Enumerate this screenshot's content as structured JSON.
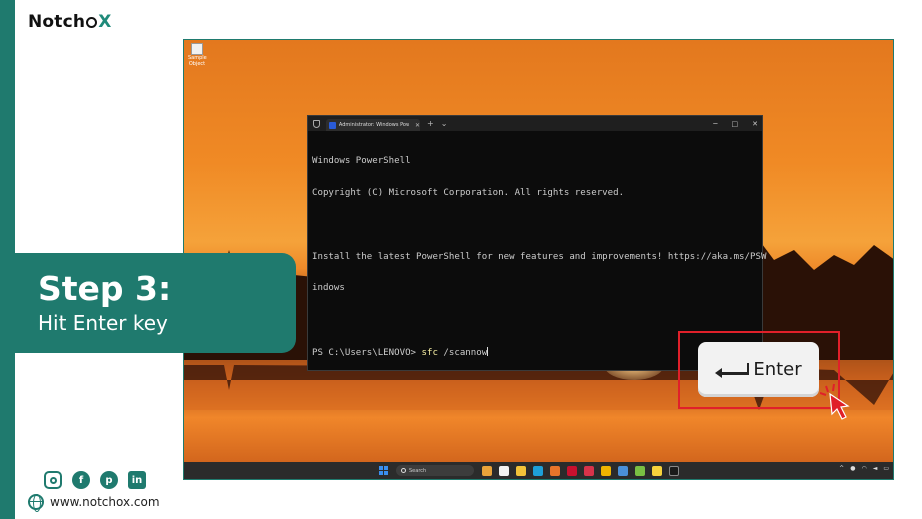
{
  "brand": {
    "name_part1": "Notch",
    "name_part2": "X"
  },
  "step": {
    "title": "Step 3:",
    "subtitle": "Hit Enter key"
  },
  "footer": {
    "website": "www.notchox.com",
    "socials": [
      "instagram-icon",
      "facebook-icon",
      "pinterest-icon",
      "linkedin-icon"
    ]
  },
  "desktop": {
    "icon_label": "Sample Object"
  },
  "powershell": {
    "tab_title": "Administrator: Windows Pow",
    "lines": [
      "Windows PowerShell",
      "Copyright (C) Microsoft Corporation. All rights reserved.",
      "",
      "Install the latest PowerShell for new features and improvements! https://aka.ms/PSW",
      "indows",
      ""
    ],
    "prompt": "PS C:\\Users\\LENOVO> ",
    "command": "sfc",
    "args": " /scannow",
    "controls": {
      "minimize": "─",
      "maximize": "□",
      "close": "✕"
    }
  },
  "overlay": {
    "enter_label": "Enter"
  },
  "taskbar": {
    "search_placeholder": "Search"
  },
  "colors": {
    "brand": "#1f7a6e",
    "highlight": "#e0202a"
  }
}
